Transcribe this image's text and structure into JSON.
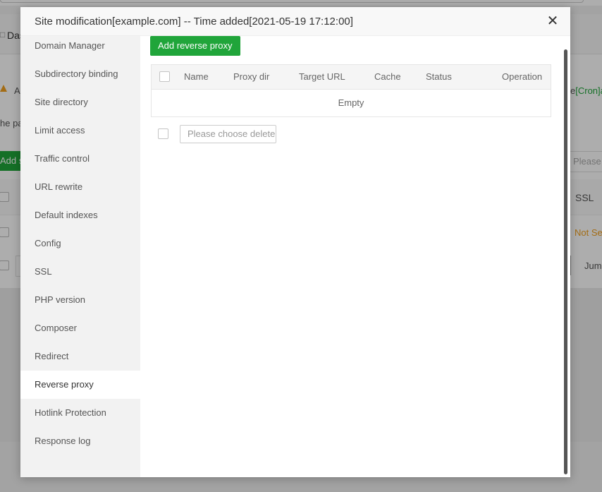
{
  "background": {
    "header_title": "Das",
    "warn_text": "A",
    "warn_right_prefix": "e",
    "warn_right_link": "[Cron]a",
    "line_text": "he pa",
    "add_button_label": "Add si",
    "search_placeholder": "Please c",
    "ssl_header": "SSL",
    "ssl_status": "Not Se",
    "jump_label": "Jum"
  },
  "modal": {
    "title": "Site modification[example.com] -- Time added[2021-05-19 17:12:00]",
    "close_icon": "close-icon"
  },
  "sidebar": {
    "items": [
      {
        "label": "Domain Manager"
      },
      {
        "label": "Subdirectory binding"
      },
      {
        "label": "Site directory"
      },
      {
        "label": "Limit access"
      },
      {
        "label": "Traffic control"
      },
      {
        "label": "URL rewrite"
      },
      {
        "label": "Default indexes"
      },
      {
        "label": "Config"
      },
      {
        "label": "SSL"
      },
      {
        "label": "PHP version"
      },
      {
        "label": "Composer"
      },
      {
        "label": "Redirect"
      },
      {
        "label": "Reverse proxy"
      },
      {
        "label": "Hotlink Protection"
      },
      {
        "label": "Response log"
      }
    ],
    "active": "Reverse proxy"
  },
  "content": {
    "add_button_label": "Add reverse proxy",
    "table": {
      "columns": [
        "Name",
        "Proxy dir",
        "Target URL",
        "Cache",
        "Status",
        "Operation"
      ],
      "empty_text": "Empty"
    },
    "batch_select_placeholder": "Please choose delete"
  },
  "colors": {
    "accent_green": "#20a53a",
    "warning_orange": "#f0a020"
  }
}
